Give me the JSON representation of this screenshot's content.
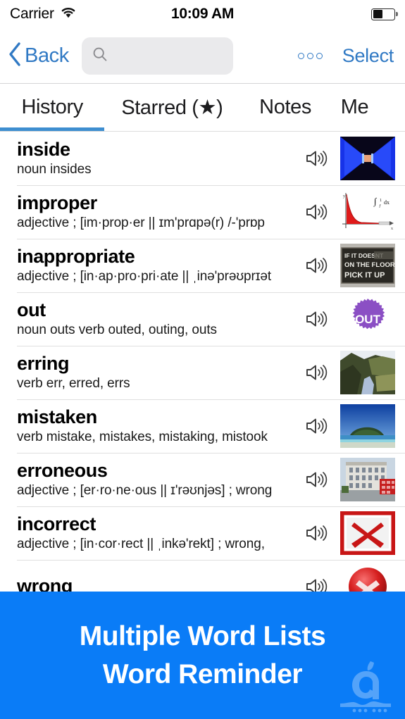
{
  "status_bar": {
    "carrier": "Carrier",
    "wifi_icon": "wifi-icon",
    "time": "10:09 AM",
    "battery_icon": "battery-icon",
    "battery_level_pct": 46
  },
  "nav_bar": {
    "back_label": "Back",
    "back_icon": "chevron-left-icon",
    "search": {
      "value": "",
      "placeholder": "",
      "icon": "search-icon"
    },
    "more_icon": "more-dots-icon",
    "select_label": "Select"
  },
  "tabs": {
    "active_index": 0,
    "items": [
      {
        "label": "History"
      },
      {
        "label": "Starred (★)"
      },
      {
        "label": "Notes"
      },
      {
        "label": "Me"
      }
    ]
  },
  "list": {
    "speaker_icon": "speaker-icon",
    "rows": [
      {
        "word": "inside",
        "definition": "noun insides",
        "thumb": "inside-tunnel-blue"
      },
      {
        "word": "improper",
        "definition": "adjective ; [im·prop·er || ɪm'prɑpə(r) /-'prɒp",
        "thumb": "improper-integral-chart"
      },
      {
        "word": "inappropriate",
        "definition": "adjective ; [in·ap·pro·pri·ate || ˌinə'prəʊprɪət",
        "thumb": "pick-it-up-sign"
      },
      {
        "word": "out",
        "definition": "noun outs verb outed, outing, outs",
        "thumb": "out-purple-badge"
      },
      {
        "word": "erring",
        "definition": "verb err, erred, errs",
        "thumb": "river-landscape"
      },
      {
        "word": "mistaken",
        "definition": "verb mistake, mistakes, mistaking, mistook",
        "thumb": "island-seascape"
      },
      {
        "word": "erroneous",
        "definition": "adjective ; [er·ro·ne·ous || ɪ'rəʊnjəs] ; wrong",
        "thumb": "building-street"
      },
      {
        "word": "incorrect",
        "definition": "adjective ; [in·cor·rect || ˌinkə'rekt] ; wrong,",
        "thumb": "red-x-box"
      },
      {
        "word": "wrong",
        "definition": "",
        "thumb": "red-x-circle"
      }
    ]
  },
  "promo_banner": {
    "line1": "Multiple Word Lists",
    "line2": "Word Reminder",
    "watermark_icon": "sibapp-watermark-logo",
    "background_color": "#0a7cf7"
  },
  "colors": {
    "accent_blue": "#3079c4",
    "tab_underline": "#3e8ed0",
    "banner_blue": "#0a7cf7",
    "search_bg": "#eaeaec",
    "separator": "#dfdfdf"
  }
}
